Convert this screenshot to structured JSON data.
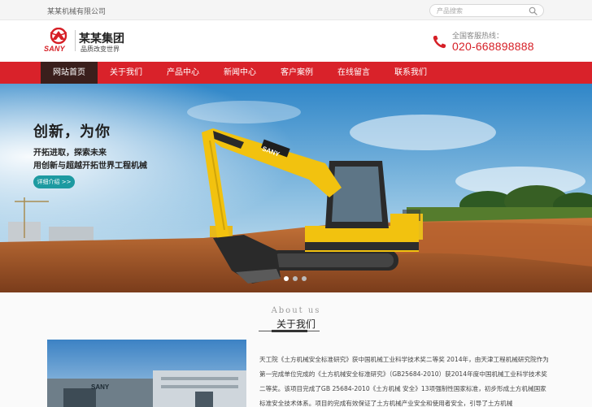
{
  "topbar": {
    "company_name": "某某机械有限公司",
    "search_placeholder": "产品搜索"
  },
  "header": {
    "logo_brand": "SANY",
    "group_name": "某某集团",
    "slogan": "品质改变世界",
    "hotline_label": "全国客服热线：",
    "hotline_number": "020-668898888"
  },
  "nav": {
    "items": [
      "网站首页",
      "关于我们",
      "产品中心",
      "新闻中心",
      "客户案例",
      "在线留言",
      "联系我们"
    ],
    "active_index": 0
  },
  "banner": {
    "headline": "创新，为你",
    "line1": "开拓进取，探索未来",
    "line2": "用创新与超越开拓世界工程机械",
    "button": "详细介绍 >>",
    "machine_brand": "SANY",
    "slide_count": 3,
    "active_slide": 1
  },
  "about": {
    "title_en": "About us",
    "title_cn": "关于我们",
    "description": "天工院《土方机械安全标准研究》获中国机械工业科学技术奖二等奖 2014年，由天津工程机械研究院作为第一完成单位完成的《土方机械安全标准研究》（GB25684-2010）获2014年度中国机械工业科学技术奖二等奖。该项目完成了GB 25684-2010《土方机械 安全》13项强制性国家标准，初步形成土方机械国家标准安全技术体系。项目的完成有效保证了土方机械产业安全和使用者安全，引导了土方机械",
    "photo_sign": "SANY"
  },
  "colors": {
    "brand_red": "#d9222a",
    "nav_active": "#3a1f1c",
    "button_teal": "#1d9aa1",
    "machine_yellow": "#f2c20f"
  }
}
